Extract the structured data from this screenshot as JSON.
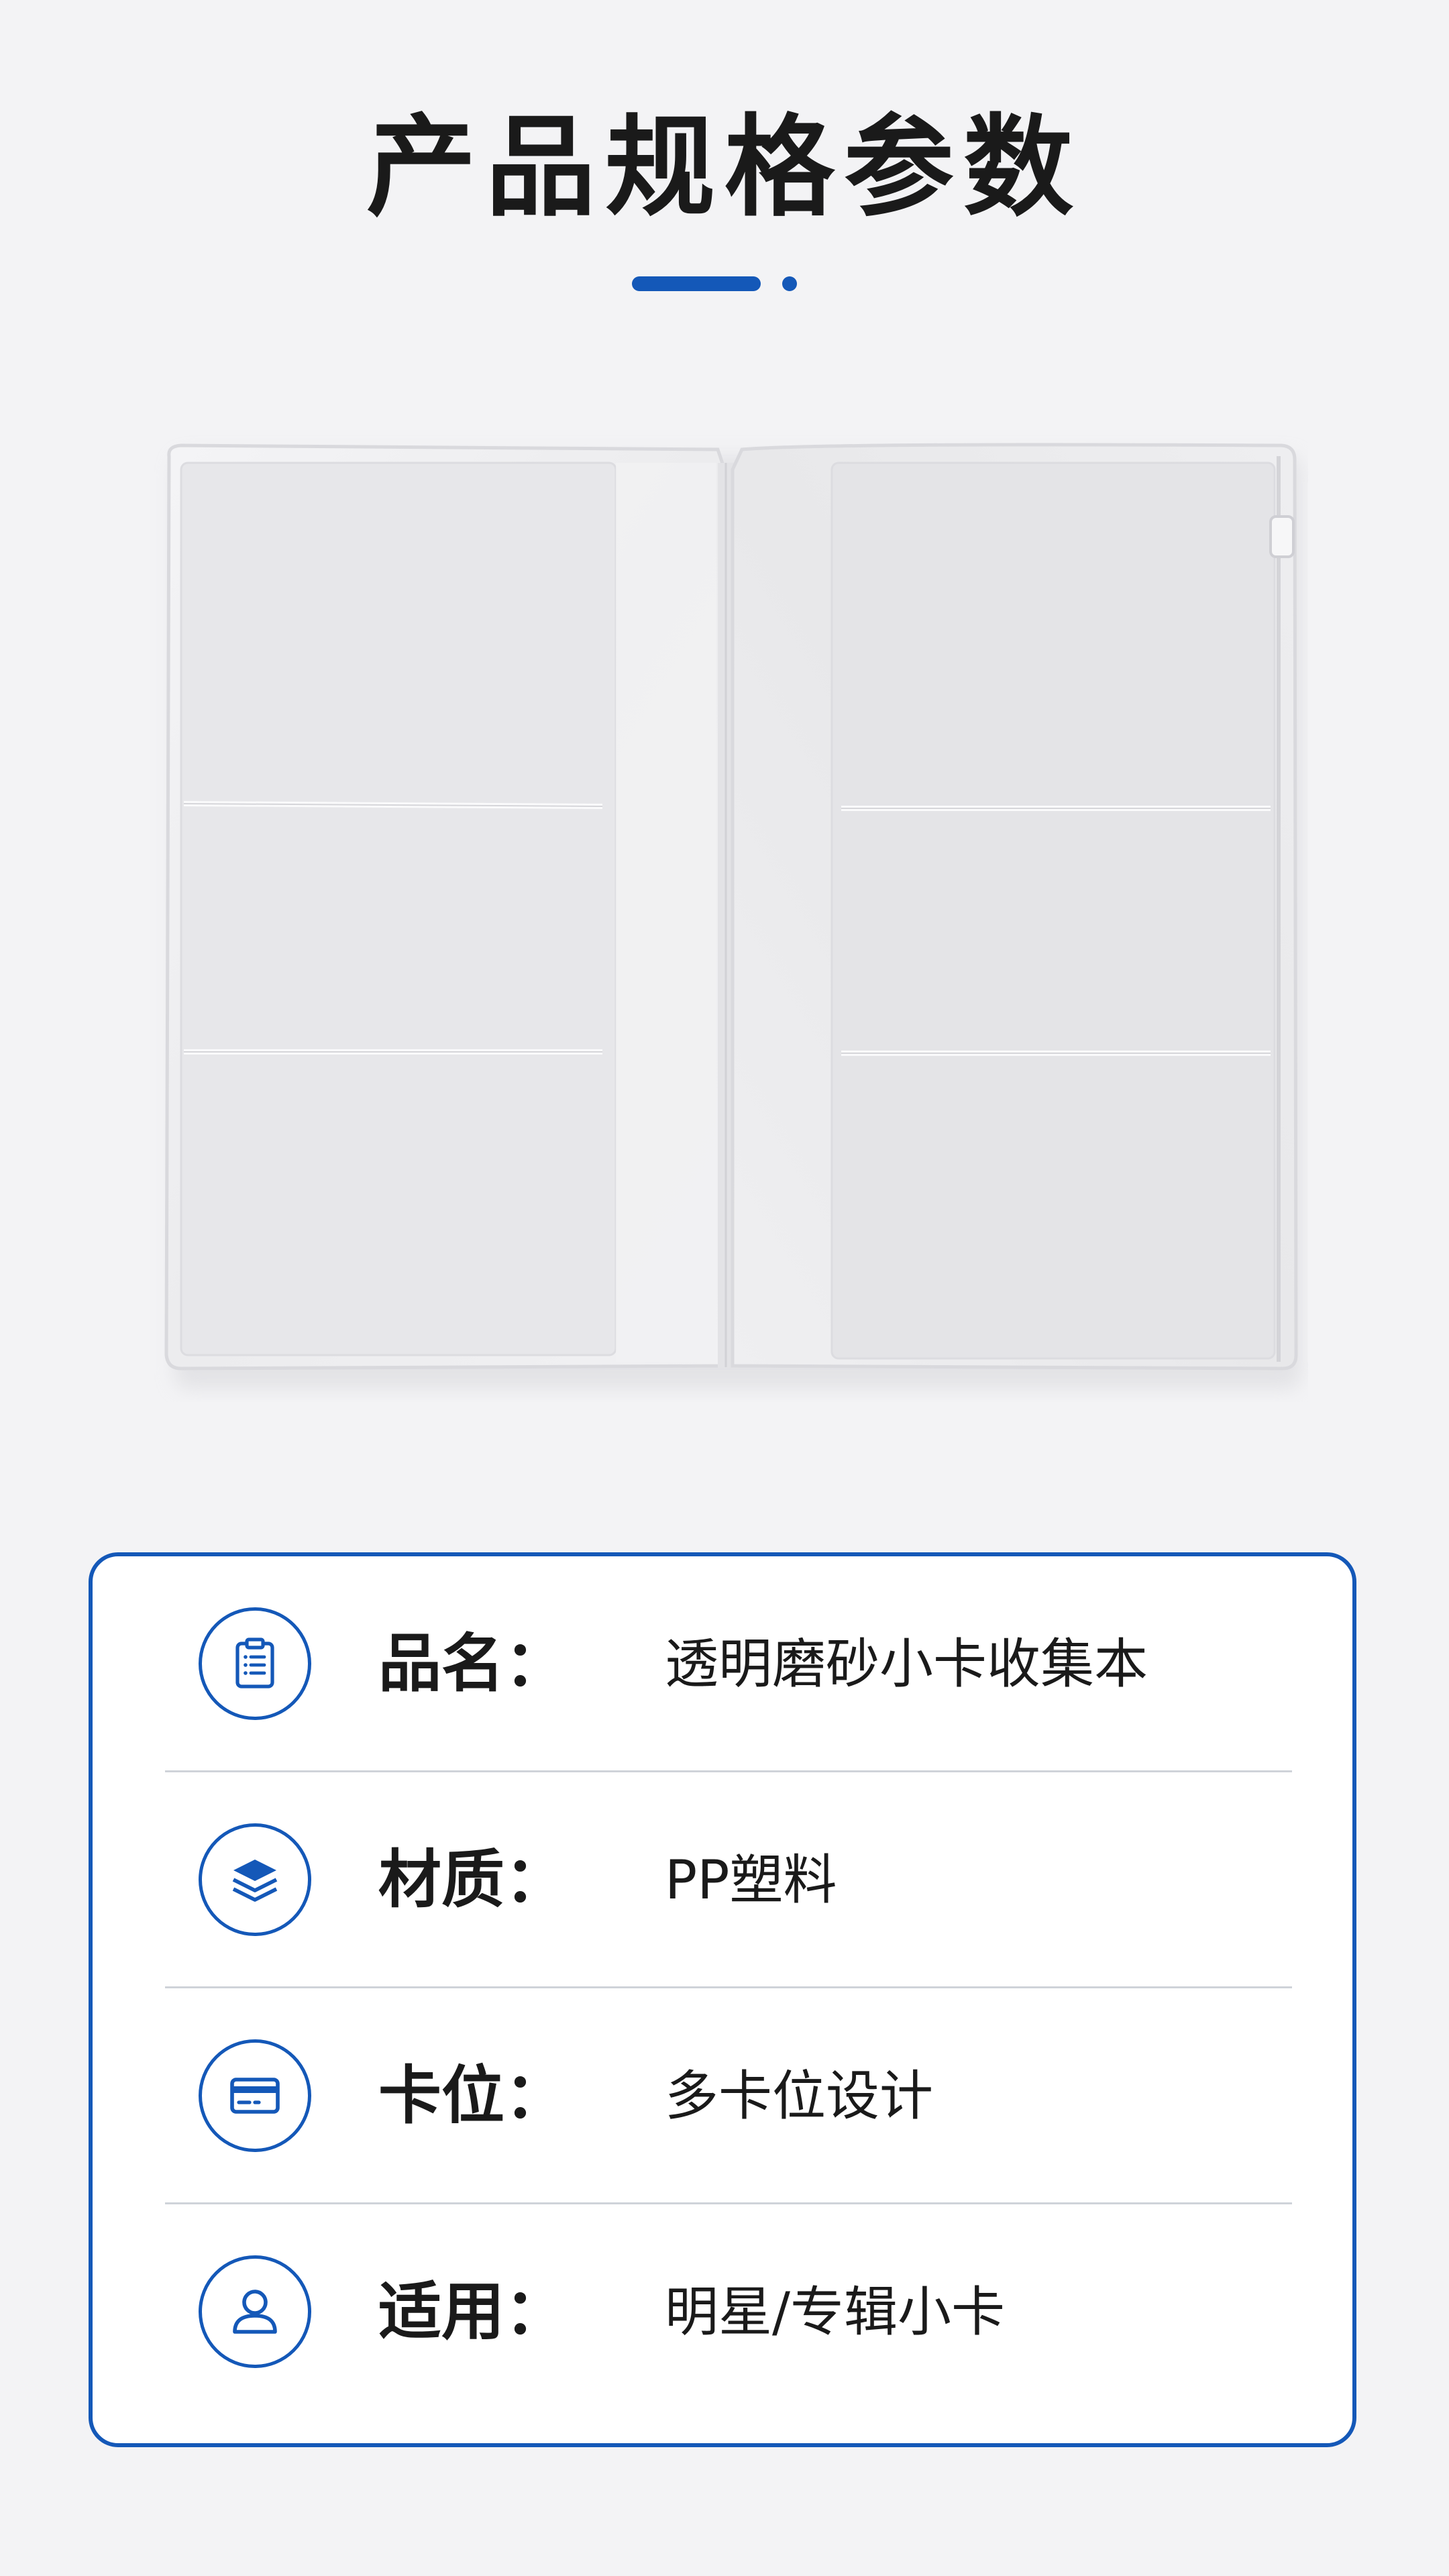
{
  "title": "产品规格参数",
  "colors": {
    "accent": "#1458b8",
    "background": "#f3f3f5",
    "divider": "#cfd3d9",
    "text": "#1a1a1a"
  },
  "product_image": {
    "description_icon": "open-transparent-card-binder"
  },
  "specs": [
    {
      "icon": "clipboard-list-icon",
      "label": "品名：",
      "value": "透明磨砂小卡收集本"
    },
    {
      "icon": "layers-icon",
      "label": "材质：",
      "value": "PP塑料"
    },
    {
      "icon": "credit-card-icon",
      "label": "卡位：",
      "value": "多卡位设计"
    },
    {
      "icon": "user-icon",
      "label": "适用：",
      "value": "明星/专辑小卡"
    }
  ]
}
